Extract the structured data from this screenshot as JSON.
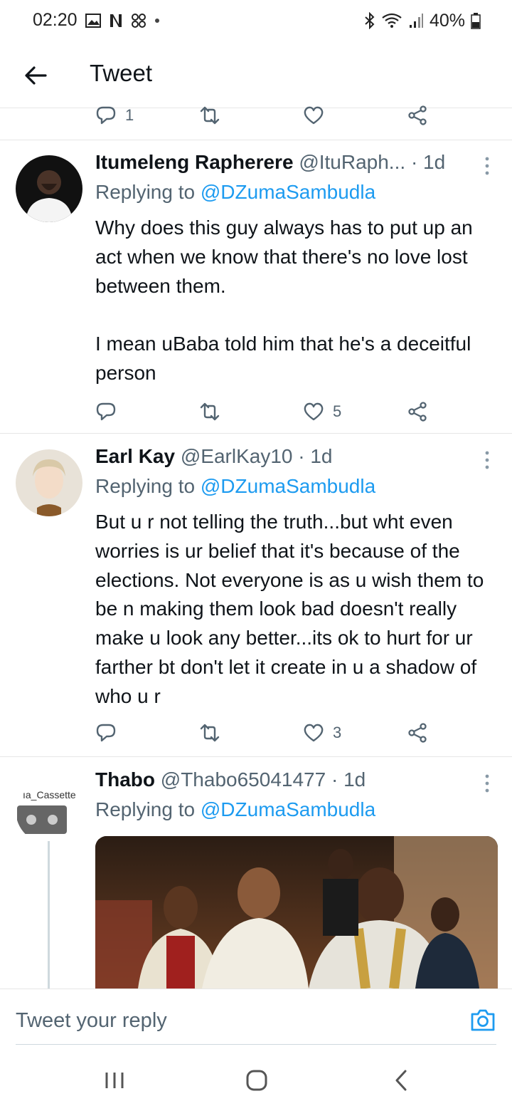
{
  "status_bar": {
    "time": "02:20",
    "battery": "40%"
  },
  "app_bar": {
    "title": "Tweet"
  },
  "previous_tweet_actions": {
    "reply_count": "1"
  },
  "tweets": [
    {
      "name": "Itumeleng Rapherere",
      "handle": "@ItuRaph...",
      "time": "· 1d",
      "replying_prefix": "Replying to",
      "replying_to": "@DZumaSambudla",
      "text": "Why does this guy always has to put up an act when we know that there's no love lost between them.\n\nI mean uBaba told him that he's a deceitful person",
      "reply_count": "",
      "retweet_count": "",
      "like_count": "5"
    },
    {
      "name": "Earl Kay",
      "handle": "@EarlKay10",
      "time": "· 1d",
      "replying_prefix": "Replying to",
      "replying_to": "@DZumaSambudla",
      "text": "But u r not telling the truth...but wht even worries is ur belief that it's because of the elections. Not everyone is as u wish them to be n making them look bad doesn't really make u look any better...its ok to hurt for ur farther bt don't let it create in u a shadow of who u r",
      "reply_count": "",
      "retweet_count": "",
      "like_count": "3"
    },
    {
      "name": "Thabo",
      "handle": "@Thabo65041477",
      "time": "· 1d",
      "replying_prefix": "Replying to",
      "replying_to": "@DZumaSambudla",
      "avatar_text": "ıa_Cassette"
    }
  ],
  "reply_box": {
    "placeholder": "Tweet your reply"
  },
  "colors": {
    "link": "#1d9bf0",
    "secondary_text": "#536471",
    "primary_text": "#0f1419",
    "divider": "#e6e6e6"
  },
  "icons": [
    "back-arrow-icon",
    "reply-icon",
    "retweet-icon",
    "like-icon",
    "share-icon",
    "more-icon",
    "camera-icon",
    "recents-icon",
    "home-icon",
    "nav-back-icon",
    "bluetooth-icon",
    "wifi-icon",
    "signal-icon",
    "battery-icon"
  ]
}
